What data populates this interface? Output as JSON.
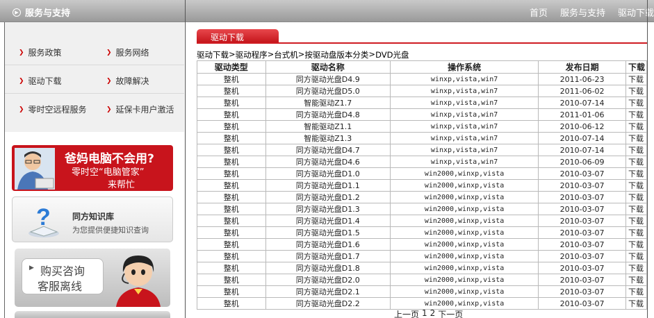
{
  "header": {
    "brand": "服务与支持",
    "nav": [
      "首页",
      "服务与支持",
      "驱动下载"
    ]
  },
  "sidebar": {
    "menu": [
      [
        "服务政策",
        "服务网络"
      ],
      [
        "驱动下载",
        "故障解决"
      ],
      [
        "零时空远程服务",
        "延保卡用户激活"
      ]
    ],
    "banner1": {
      "title": "爸妈电脑不会用?",
      "line2": "零时空“电脑管家”",
      "line3": "来帮忙"
    },
    "banner2": {
      "title": "同方知识库",
      "subtitle": "为您提供便捷知识查询"
    },
    "banner3": {
      "line1": "购买咨询",
      "line2": "客服离线"
    }
  },
  "main": {
    "tab": "驱动下载",
    "breadcrumb": [
      "驱动下载",
      "驱动程序",
      "台式机",
      "按驱动盘版本分类",
      "DVD光盘"
    ],
    "columns": [
      "驱动类型",
      "驱动名称",
      "操作系统",
      "发布日期",
      "下载"
    ],
    "rows": [
      [
        "整机",
        "同方驱动光盘D4.9",
        "winxp,vista,win7",
        "2011-06-23",
        "下载"
      ],
      [
        "整机",
        "同方驱动光盘D5.0",
        "winxp,vista,win7",
        "2011-06-02",
        "下载"
      ],
      [
        "整机",
        "智能驱动Z1.7",
        "winxp,vista,win7",
        "2010-07-14",
        "下载"
      ],
      [
        "整机",
        "同方驱动光盘D4.8",
        "winxp,vista,win7",
        "2011-01-06",
        "下载"
      ],
      [
        "整机",
        "智能驱动Z1.1",
        "winxp,vista,win7",
        "2010-06-12",
        "下载"
      ],
      [
        "整机",
        "智能驱动Z1.3",
        "winxp,vista,win7",
        "2010-07-14",
        "下载"
      ],
      [
        "整机",
        "同方驱动光盘D4.7",
        "winxp,vista,win7",
        "2010-07-14",
        "下载"
      ],
      [
        "整机",
        "同方驱动光盘D4.6",
        "winxp,vista,win7",
        "2010-06-09",
        "下载"
      ],
      [
        "整机",
        "同方驱动光盘D1.0",
        "win2000,winxp,vista",
        "2010-03-07",
        "下载"
      ],
      [
        "整机",
        "同方驱动光盘D1.1",
        "win2000,winxp,vista",
        "2010-03-07",
        "下载"
      ],
      [
        "整机",
        "同方驱动光盘D1.2",
        "win2000,winxp,vista",
        "2010-03-07",
        "下载"
      ],
      [
        "整机",
        "同方驱动光盘D1.3",
        "win2000,winxp,vista",
        "2010-03-07",
        "下载"
      ],
      [
        "整机",
        "同方驱动光盘D1.4",
        "win2000,winxp,vista",
        "2010-03-07",
        "下载"
      ],
      [
        "整机",
        "同方驱动光盘D1.5",
        "win2000,winxp,vista",
        "2010-03-07",
        "下载"
      ],
      [
        "整机",
        "同方驱动光盘D1.6",
        "win2000,winxp,vista",
        "2010-03-07",
        "下载"
      ],
      [
        "整机",
        "同方驱动光盘D1.7",
        "win2000,winxp,vista",
        "2010-03-07",
        "下载"
      ],
      [
        "整机",
        "同方驱动光盘D1.8",
        "win2000,winxp,vista",
        "2010-03-07",
        "下载"
      ],
      [
        "整机",
        "同方驱动光盘D2.0",
        "win2000,winxp,vista",
        "2010-03-07",
        "下载"
      ],
      [
        "整机",
        "同方驱动光盘D2.1",
        "win2000,winxp,vista",
        "2010-03-07",
        "下载"
      ],
      [
        "整机",
        "同方驱动光盘D2.2",
        "win2000,winxp,vista",
        "2010-03-07",
        "下载"
      ]
    ],
    "pager": {
      "prev": "上一页",
      "pages": [
        "1",
        "2"
      ],
      "next": "下一页"
    }
  },
  "colors": {
    "accent": "#cf1b22",
    "topbar": "#a8a8a8"
  }
}
